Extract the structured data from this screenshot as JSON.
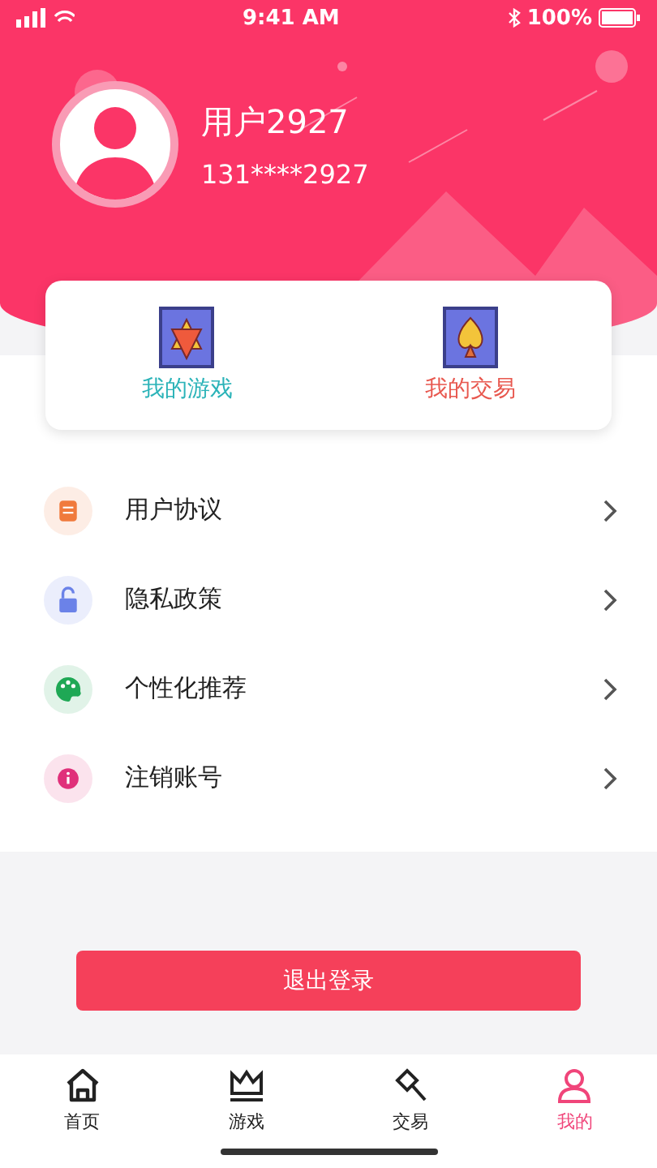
{
  "status_bar": {
    "time": "9:41 AM",
    "battery": "100%"
  },
  "profile": {
    "name": "用户2927",
    "phone": "131****2927"
  },
  "shortcuts": [
    {
      "kind": "game",
      "label": "我的游戏",
      "color": "#2bb3b8"
    },
    {
      "kind": "trade",
      "label": "我的交易",
      "color": "#e8584f"
    }
  ],
  "menu": [
    {
      "kind": "doc",
      "label": "用户协议",
      "color": "#f07a3c"
    },
    {
      "kind": "lock",
      "label": "隐私政策",
      "color": "#6b82e8"
    },
    {
      "kind": "palette",
      "label": "个性化推荐",
      "color": "#1fa855"
    },
    {
      "kind": "info",
      "label": "注销账号",
      "color": "#e0307a"
    }
  ],
  "logout_button": "退出登录",
  "tabs": [
    {
      "kind": "home",
      "label": "首页",
      "selected": false
    },
    {
      "kind": "crown",
      "label": "游戏",
      "selected": false
    },
    {
      "kind": "hammer",
      "label": "交易",
      "selected": false
    },
    {
      "kind": "user",
      "label": "我的",
      "selected": true
    }
  ]
}
